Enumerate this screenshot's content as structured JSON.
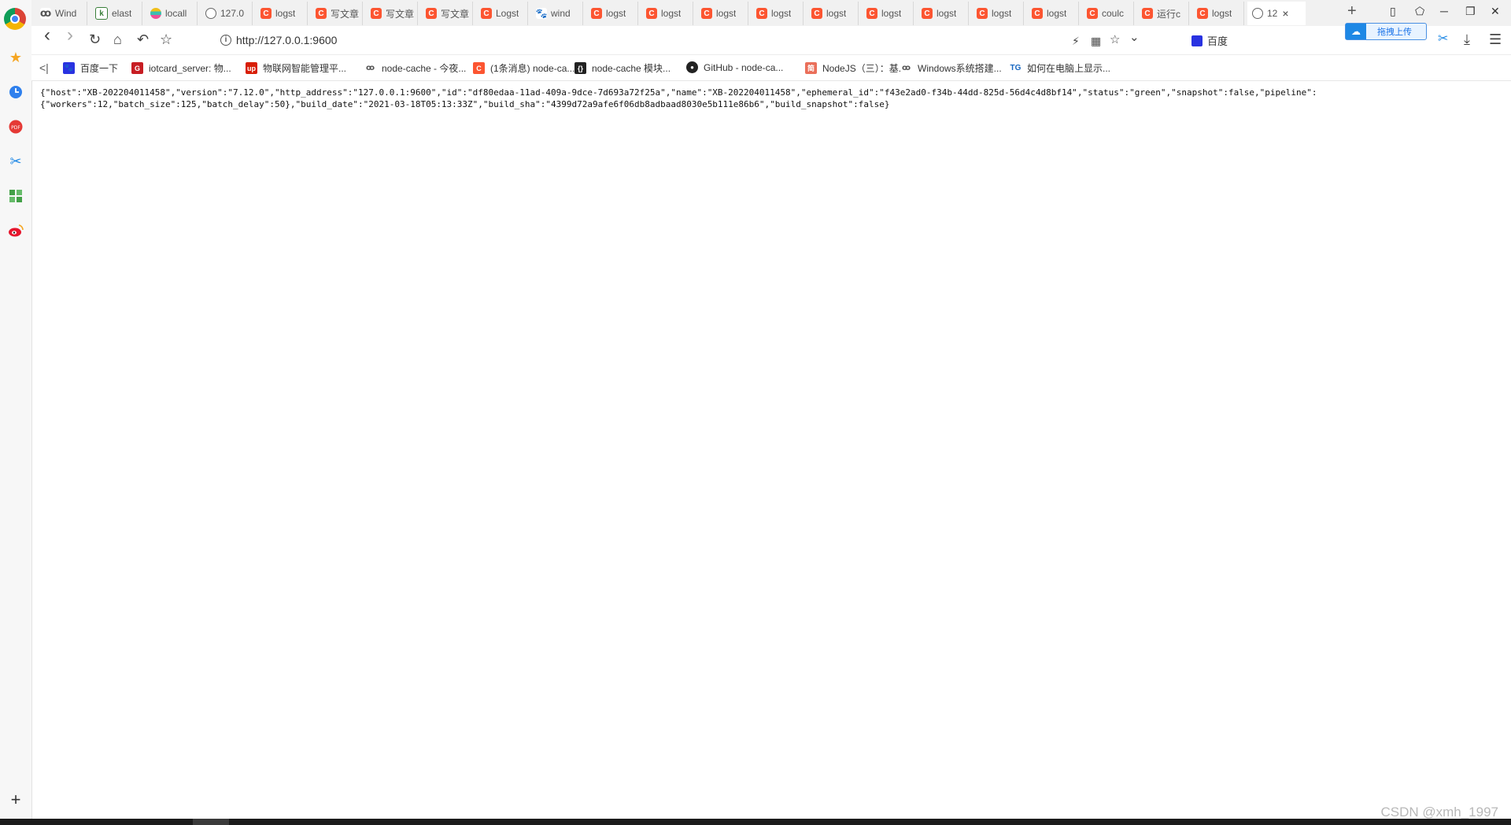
{
  "tabs": [
    {
      "label": "Wind",
      "favicon": "mirror"
    },
    {
      "label": "elast",
      "favicon": "kibana"
    },
    {
      "label": "locall",
      "favicon": "elastic"
    },
    {
      "label": "127.0",
      "favicon": "globe"
    },
    {
      "label": "logst",
      "favicon": "csdn"
    },
    {
      "label": "写文章",
      "favicon": "csdn"
    },
    {
      "label": "写文章",
      "favicon": "csdn"
    },
    {
      "label": "写文章",
      "favicon": "csdn"
    },
    {
      "label": "Logst",
      "favicon": "csdn"
    },
    {
      "label": "wind",
      "favicon": "baidu"
    },
    {
      "label": "logst",
      "favicon": "csdn"
    },
    {
      "label": "logst",
      "favicon": "csdn"
    },
    {
      "label": "logst",
      "favicon": "csdn"
    },
    {
      "label": "logst",
      "favicon": "csdn"
    },
    {
      "label": "logst",
      "favicon": "csdn"
    },
    {
      "label": "logst",
      "favicon": "csdn"
    },
    {
      "label": "logst",
      "favicon": "csdn"
    },
    {
      "label": "logst",
      "favicon": "csdn"
    },
    {
      "label": "logst",
      "favicon": "csdn"
    },
    {
      "label": "coulc",
      "favicon": "csdn"
    },
    {
      "label": "运行c",
      "favicon": "csdn"
    },
    {
      "label": "logst",
      "favicon": "csdn"
    }
  ],
  "active_tab": {
    "label": "12",
    "favicon": "globe",
    "close": "×"
  },
  "new_tab": "+",
  "window_controls": {
    "compact": "▯",
    "skin": "⬠",
    "minimize": "─",
    "restore": "❐",
    "close": "✕"
  },
  "address_bar": {
    "url": "http://127.0.0.1:9600",
    "info_icon": "i"
  },
  "nav_icons": {
    "back": "‹",
    "forward": "›",
    "reload": "↻",
    "home": "⌂",
    "undo": "↶",
    "favorite": "☆"
  },
  "search_engine": {
    "name": "百度"
  },
  "cloud_upload": {
    "label": "拖拽上传"
  },
  "right_icons": {
    "lightning": "⚡",
    "qr": "▦",
    "star": "☆",
    "dropdown": "⌄",
    "download": "⤓",
    "menu": "☰",
    "scissors": "✂"
  },
  "bookmarks": [
    {
      "label": "百度一下",
      "favicon": "baidu"
    },
    {
      "label": "iotcard_server: 物...",
      "favicon": "gitee"
    },
    {
      "label": "物联网智能管理平...",
      "favicon": "up"
    },
    {
      "label": "node-cache - 今夜...",
      "favicon": "mirror"
    },
    {
      "label": "(1条消息) node-ca...",
      "favicon": "csdn"
    },
    {
      "label": "node-cache 模块...",
      "favicon": "braces"
    },
    {
      "label": "GitHub - node-ca...",
      "favicon": "github"
    },
    {
      "label": "NodeJS（三）：基...",
      "favicon": "jianshu"
    },
    {
      "label": "Windows系统搭建...",
      "favicon": "mirror"
    },
    {
      "label": "如何在电脑上显示...",
      "favicon": "tg"
    }
  ],
  "bookmarks_collapse": "<|",
  "sidebar": {
    "add": "+"
  },
  "page_text": "{\"host\":\"XB-202204011458\",\"version\":\"7.12.0\",\"http_address\":\"127.0.0.1:9600\",\"id\":\"df80edaa-11ad-409a-9dce-7d693a72f25a\",\"name\":\"XB-202204011458\",\"ephemeral_id\":\"f43e2ad0-f34b-44dd-825d-56d4c4d8bf14\",\"status\":\"green\",\"snapshot\":false,\"pipeline\":\n{\"workers\":12,\"batch_size\":125,\"batch_delay\":50},\"build_date\":\"2021-03-18T05:13:33Z\",\"build_sha\":\"4399d72a9afe6f06db8adbaad8030e5b111e86b6\",\"build_snapshot\":false}",
  "watermark": "CSDN @xmh_1997",
  "colors": {
    "csdn": "#fc5531",
    "baidu": "#2932e1",
    "accent": "#1a73e8"
  }
}
